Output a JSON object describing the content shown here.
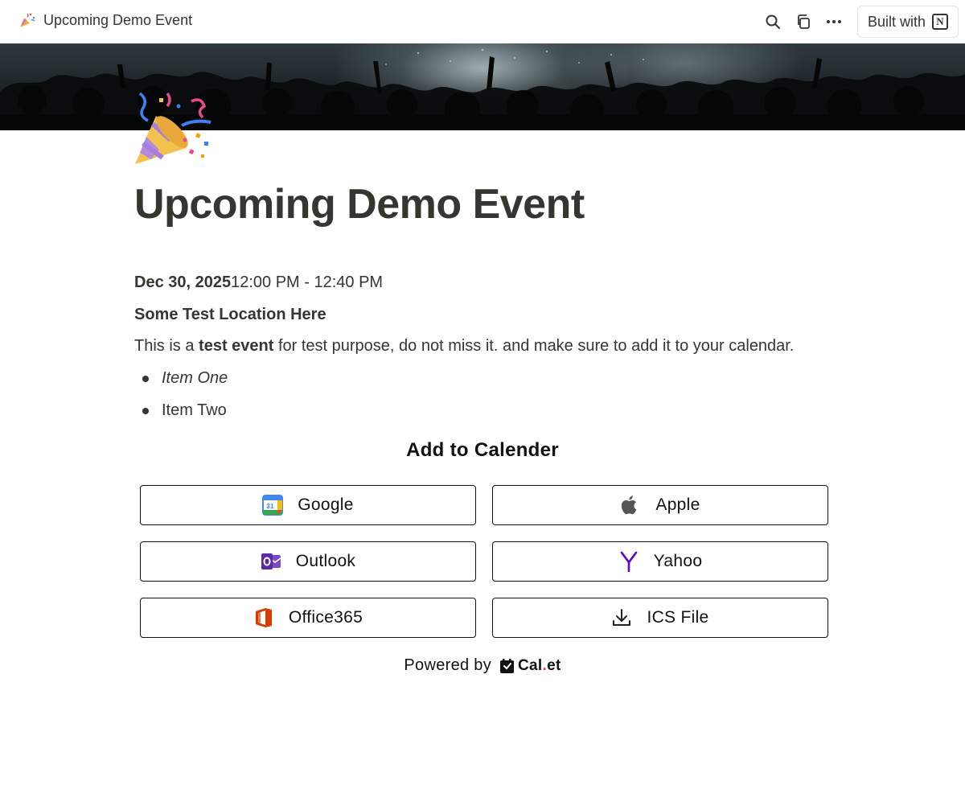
{
  "topbar": {
    "breadcrumb_title": "Upcoming Demo Event",
    "built_with_label": "Built with",
    "icons": [
      "party-popper-icon",
      "search-icon",
      "duplicate-icon",
      "more-icon",
      "notion-logo-icon"
    ]
  },
  "page": {
    "title": "Upcoming Demo Event",
    "date": "Dec 30, 2025",
    "time": "12:00 PM - 12:40 PM",
    "location": "Some Test Location Here",
    "description": {
      "before": "This is a ",
      "bold": "test event",
      "after": " for test purpose, do not miss it. and make sure to add it to your calendar."
    },
    "bullets": [
      "Item One",
      "Item Two"
    ]
  },
  "calendar": {
    "heading": "Add to Calender",
    "buttons": [
      {
        "label": "Google",
        "icon": "google-calendar-icon"
      },
      {
        "label": "Apple",
        "icon": "apple-icon"
      },
      {
        "label": "Outlook",
        "icon": "outlook-icon"
      },
      {
        "label": "Yahoo",
        "icon": "yahoo-icon"
      },
      {
        "label": "Office365",
        "icon": "office365-icon"
      },
      {
        "label": "ICS File",
        "icon": "download-icon"
      }
    ],
    "powered_by": "Powered by",
    "brand": {
      "name": "Cal",
      "dot": ".",
      "suffix": "et"
    }
  },
  "colors": {
    "text": "#37352f",
    "button_border": "#111111",
    "yahoo_purple": "#6001d2",
    "office_orange": "#d83b01",
    "outlook_blue": "#5b2aa7",
    "brand_dot": "#e8345f"
  }
}
